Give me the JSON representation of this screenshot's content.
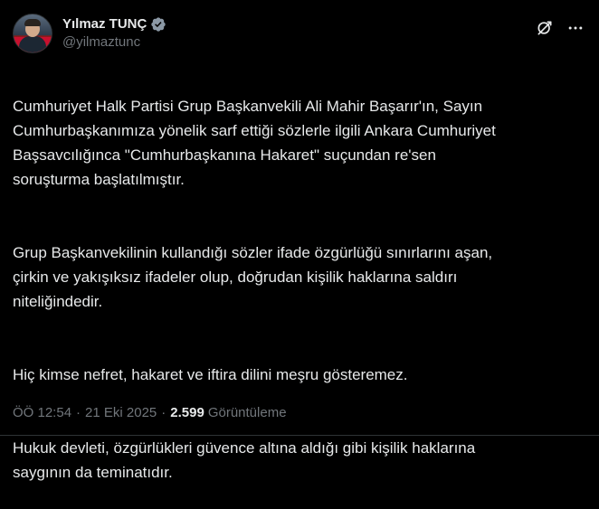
{
  "author": {
    "display_name": "Yılmaz TUNÇ",
    "handle": "@yilmaztunc",
    "verified_badge": "verified-badge-icon",
    "avatar": "avatar-image"
  },
  "actions": {
    "grok_icon": "grok-icon",
    "more_icon": "more-icon"
  },
  "tweet": {
    "paragraphs": [
      "Cumhuriyet Halk Partisi Grup Başkanvekili Ali Mahir Başarır'ın, Sayın\nCumhurbaşkanımıza yönelik sarf ettiği sözlerle ilgili Ankara Cumhuriyet\nBaşsavcılığınca \"Cumhurbaşkanına Hakaret\" suçundan re'sen\nsoruşturma başlatılmıştır.",
      "Grup Başkanvekilinin kullandığı sözler ifade özgürlüğü sınırlarını aşan,\nçirkin ve yakışıksız ifadeler olup, doğrudan kişilik haklarına saldırı\nniteliğindedir.",
      "Hiç kimse nefret, hakaret ve iftira dilini meşru gösteremez.",
      "Hukuk devleti, özgürlükleri güvence altına aldığı gibi kişilik haklarına\nsaygının da teminatıdır."
    ]
  },
  "meta": {
    "time": "ÖÖ 12:54",
    "separator_1": "·",
    "date": "21 Eki 2025",
    "separator_2": "·",
    "views_count": "2.599",
    "views_label": "Görüntüleme"
  },
  "colors": {
    "background": "#000000",
    "text_primary": "#e7e9ea",
    "text_secondary": "#71767b",
    "verified_blue": "#8b98a5",
    "border": "#2f3336"
  }
}
